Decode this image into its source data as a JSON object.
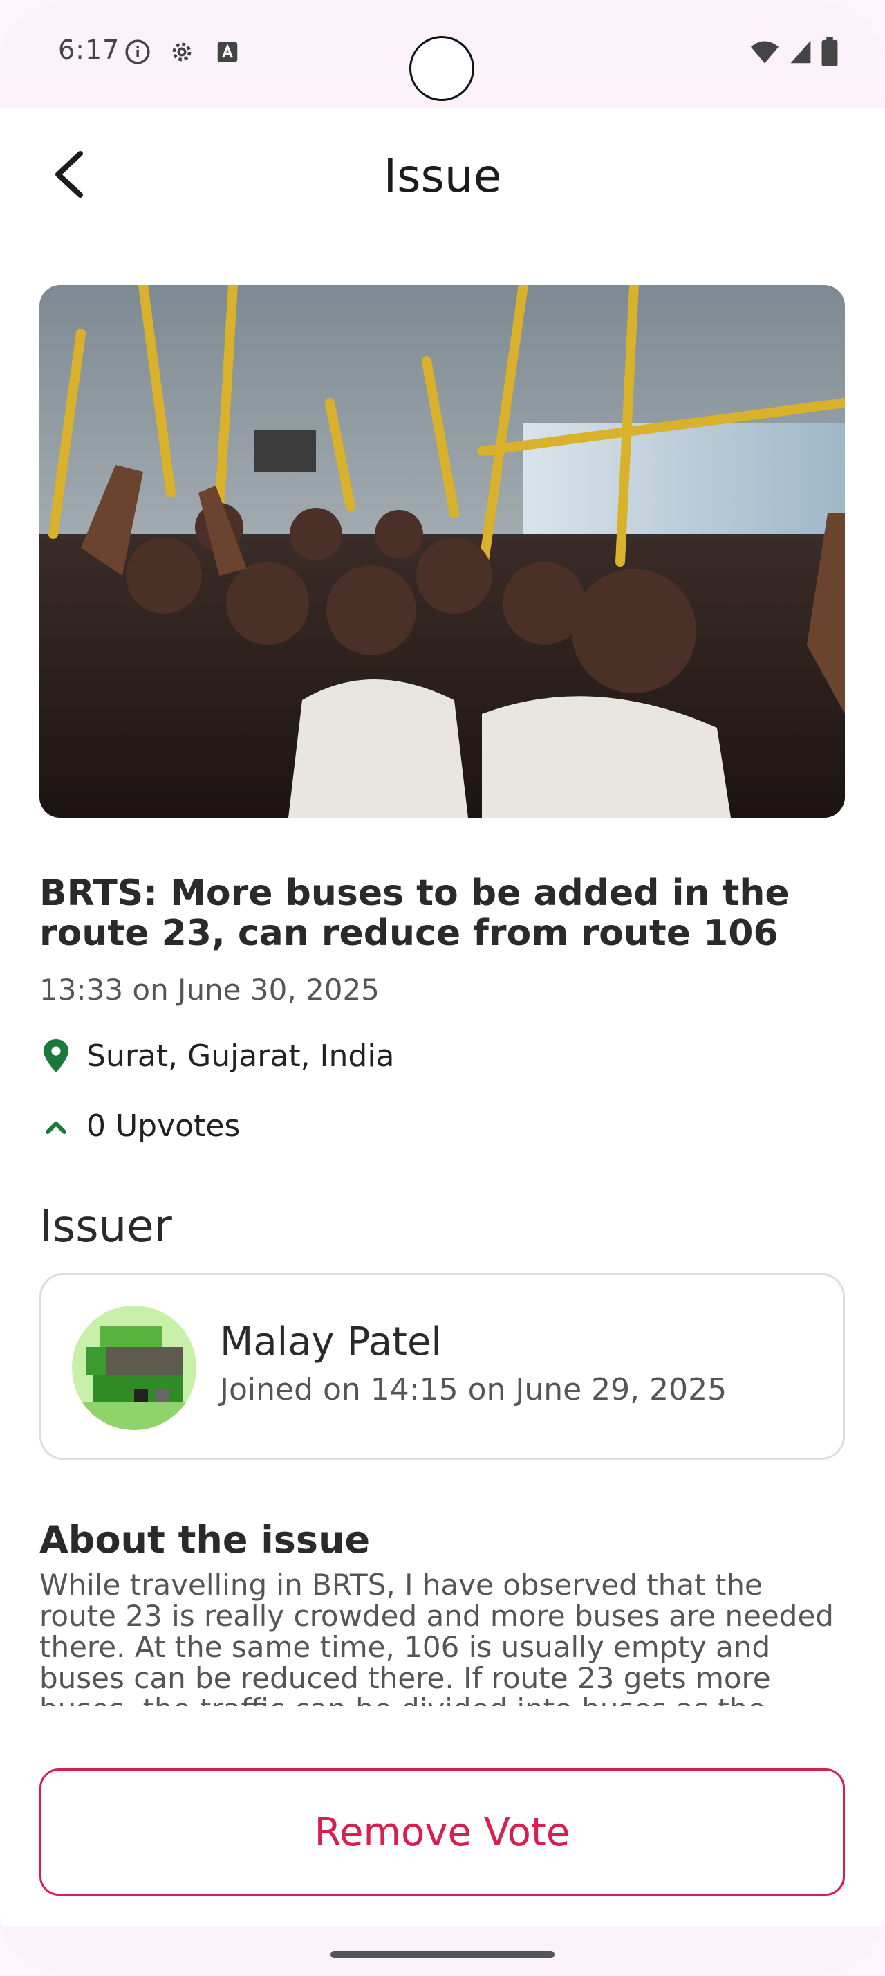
{
  "status_bar": {
    "time": "6:17",
    "icons_left": [
      "info-icon",
      "settings-icon",
      "text-a-icon"
    ],
    "icons_right": [
      "wifi-icon",
      "signal-icon",
      "battery-icon"
    ]
  },
  "app_bar": {
    "title": "Issue",
    "back_icon": "arrow-back-icon"
  },
  "issue": {
    "title": "BRTS: More buses to be added in the route 23, can reduce from route 106",
    "datetime": "13:33 on June 30, 2025",
    "location": "Surat, Gujarat, India",
    "upvotes": "0 Upvotes",
    "image_subject": "crowded bus interior"
  },
  "issuer_section": {
    "heading": "Issuer",
    "name": "Malay Patel",
    "joined": "Joined on 14:15 on June 29, 2025"
  },
  "about_section": {
    "heading": "About the issue",
    "text": "While travelling in BRTS, I have observed that the route 23 is really crowded and more buses are needed there. At the same time, 106 is usually empty and buses can be reduced there. If route 23 gets more buses, the traffic can be divided into buses as the frequency will"
  },
  "actions": {
    "remove_vote": "Remove Vote"
  },
  "colors": {
    "accent": "#d81e4c",
    "location_pin": "#1b7a3a",
    "status_bar_bg": "#fcf2fa"
  }
}
